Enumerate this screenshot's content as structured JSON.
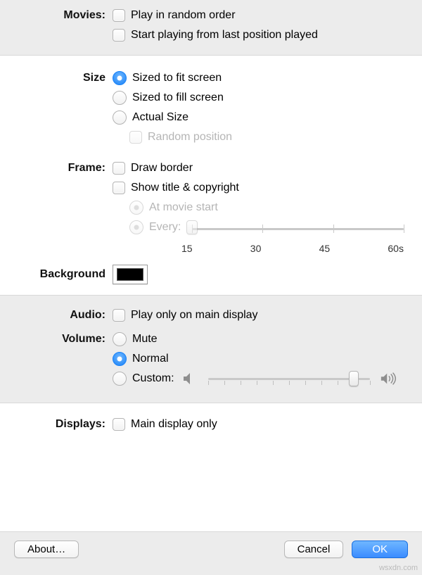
{
  "movies": {
    "label": "Movies:",
    "random_order": "Play in random order",
    "start_last": "Start playing from last position played"
  },
  "size": {
    "label": "Size",
    "fit": "Sized to fit screen",
    "fill": "Sized to fill screen",
    "actual": "Actual Size",
    "random_pos": "Random position"
  },
  "frame": {
    "label": "Frame:",
    "border": "Draw border",
    "title_copy": "Show title & copyright",
    "at_start": "At movie start",
    "every": "Every:",
    "ticks": [
      "15",
      "30",
      "45",
      "60s"
    ]
  },
  "background": {
    "label": "Background",
    "color": "#000000"
  },
  "audio": {
    "label": "Audio:",
    "main_only": "Play only on main display"
  },
  "volume": {
    "label": "Volume:",
    "mute": "Mute",
    "normal": "Normal",
    "custom": "Custom:",
    "value_percent": 90
  },
  "displays": {
    "label": "Displays:",
    "main_only": "Main display only"
  },
  "footer": {
    "about": "About…",
    "cancel": "Cancel",
    "ok": "OK"
  },
  "watermark": "wsxdn.com"
}
